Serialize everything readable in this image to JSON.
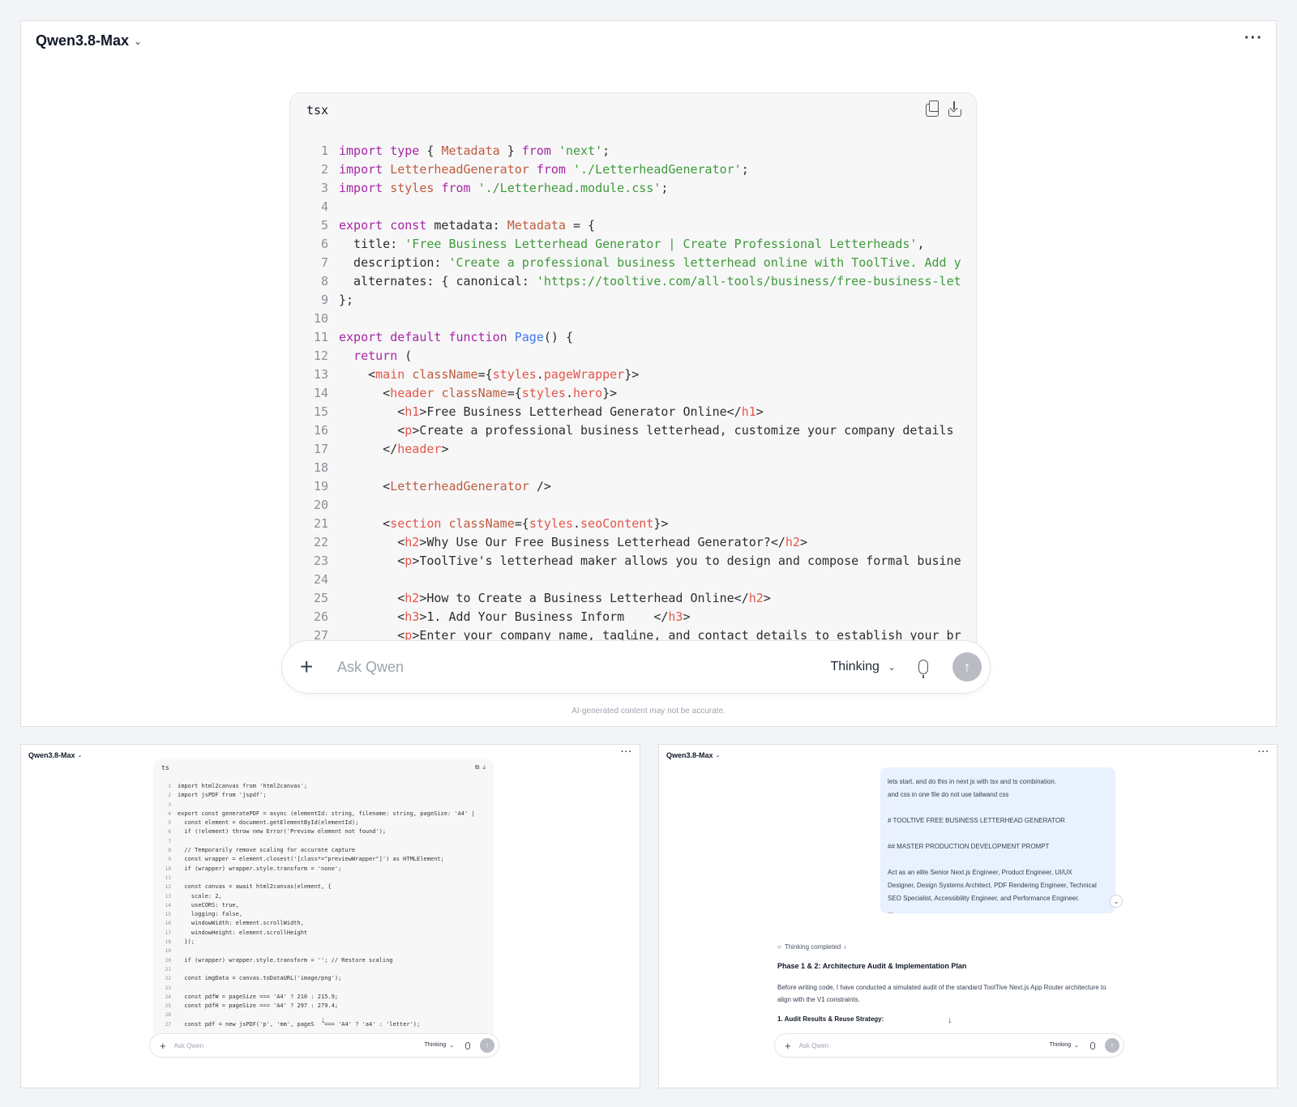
{
  "main": {
    "model_name": "Qwen3.8-Max",
    "more": "···",
    "code_lang": "tsx",
    "code_lines": [
      [
        {
          "t": "import",
          "c": "k"
        },
        {
          "t": " "
        },
        {
          "t": "type",
          "c": "k"
        },
        {
          "t": " { "
        },
        {
          "t": "Metadata",
          "c": "t"
        },
        {
          "t": " } "
        },
        {
          "t": "from",
          "c": "k"
        },
        {
          "t": " "
        },
        {
          "t": "'next'",
          "c": "s"
        },
        {
          "t": ";"
        }
      ],
      [
        {
          "t": "import",
          "c": "k"
        },
        {
          "t": " "
        },
        {
          "t": "LetterheadGenerator",
          "c": "t"
        },
        {
          "t": " "
        },
        {
          "t": "from",
          "c": "k"
        },
        {
          "t": " "
        },
        {
          "t": "'./LetterheadGenerator'",
          "c": "s"
        },
        {
          "t": ";"
        }
      ],
      [
        {
          "t": "import",
          "c": "k"
        },
        {
          "t": " "
        },
        {
          "t": "styles",
          "c": "t"
        },
        {
          "t": " "
        },
        {
          "t": "from",
          "c": "k"
        },
        {
          "t": " "
        },
        {
          "t": "'./Letterhead.module.css'",
          "c": "s"
        },
        {
          "t": ";"
        }
      ],
      [],
      [
        {
          "t": "export",
          "c": "k"
        },
        {
          "t": " "
        },
        {
          "t": "const",
          "c": "k"
        },
        {
          "t": " metadata: "
        },
        {
          "t": "Metadata",
          "c": "t"
        },
        {
          "t": " = {"
        }
      ],
      [
        {
          "t": "  title: "
        },
        {
          "t": "'Free Business Letterhead Generator | Create Professional Letterheads'",
          "c": "s"
        },
        {
          "t": ","
        }
      ],
      [
        {
          "t": "  description: "
        },
        {
          "t": "'Create a professional business letterhead online with ToolTive. Add you",
          "c": "s"
        }
      ],
      [
        {
          "t": "  alternates: { canonical: "
        },
        {
          "t": "'https://tooltive.com/all-tools/business/free-business-lette",
          "c": "s"
        }
      ],
      [
        {
          "t": "};"
        }
      ],
      [],
      [
        {
          "t": "export",
          "c": "k"
        },
        {
          "t": " "
        },
        {
          "t": "default",
          "c": "k"
        },
        {
          "t": " "
        },
        {
          "t": "function",
          "c": "k"
        },
        {
          "t": " "
        },
        {
          "t": "Page",
          "c": "f"
        },
        {
          "t": "() {"
        }
      ],
      [
        {
          "t": "  "
        },
        {
          "t": "return",
          "c": "k"
        },
        {
          "t": " ("
        }
      ],
      [
        {
          "t": "    <"
        },
        {
          "t": "main",
          "c": "tg"
        },
        {
          "t": " "
        },
        {
          "t": "className",
          "c": "t"
        },
        {
          "t": "={"
        },
        {
          "t": "styles",
          "c": "tg"
        },
        {
          "t": "."
        },
        {
          "t": "pageWrapper",
          "c": "tg"
        },
        {
          "t": "}>"
        }
      ],
      [
        {
          "t": "      <"
        },
        {
          "t": "header",
          "c": "tg"
        },
        {
          "t": " "
        },
        {
          "t": "className",
          "c": "t"
        },
        {
          "t": "={"
        },
        {
          "t": "styles",
          "c": "tg"
        },
        {
          "t": "."
        },
        {
          "t": "hero",
          "c": "tg"
        },
        {
          "t": "}>"
        }
      ],
      [
        {
          "t": "        <"
        },
        {
          "t": "h1",
          "c": "tg"
        },
        {
          "t": ">Free Business Letterhead Generator Online</"
        },
        {
          "t": "h1",
          "c": "tg"
        },
        {
          "t": ">"
        }
      ],
      [
        {
          "t": "        <"
        },
        {
          "t": "p",
          "c": "tg"
        },
        {
          "t": ">Create a professional business letterhead, customize your company details ar"
        }
      ],
      [
        {
          "t": "      </"
        },
        {
          "t": "header",
          "c": "tg"
        },
        {
          "t": ">"
        }
      ],
      [],
      [
        {
          "t": "      <"
        },
        {
          "t": "LetterheadGenerator",
          "c": "t"
        },
        {
          "t": " />"
        }
      ],
      [],
      [
        {
          "t": "      <"
        },
        {
          "t": "section",
          "c": "tg"
        },
        {
          "t": " "
        },
        {
          "t": "className",
          "c": "t"
        },
        {
          "t": "={"
        },
        {
          "t": "styles",
          "c": "tg"
        },
        {
          "t": "."
        },
        {
          "t": "seoContent",
          "c": "tg"
        },
        {
          "t": "}>"
        }
      ],
      [
        {
          "t": "        <"
        },
        {
          "t": "h2",
          "c": "tg"
        },
        {
          "t": ">Why Use Our Free Business Letterhead Generator?</"
        },
        {
          "t": "h2",
          "c": "tg"
        },
        {
          "t": ">"
        }
      ],
      [
        {
          "t": "        <"
        },
        {
          "t": "p",
          "c": "tg"
        },
        {
          "t": ">ToolTive's letterhead maker allows you to design and compose formal business"
        }
      ],
      [],
      [
        {
          "t": "        <"
        },
        {
          "t": "h2",
          "c": "tg"
        },
        {
          "t": ">How to Create a Business Letterhead Online</"
        },
        {
          "t": "h2",
          "c": "tg"
        },
        {
          "t": ">"
        }
      ],
      [
        {
          "t": "        <"
        },
        {
          "t": "h3",
          "c": "tg"
        },
        {
          "t": ">1. Add Your Business Inform    </"
        },
        {
          "t": "h3",
          "c": "tg"
        },
        {
          "t": ">"
        }
      ],
      [
        {
          "t": "        <"
        },
        {
          "t": "p",
          "c": "tg"
        },
        {
          "t": ">Enter your company name, tagline, and contact details to establish your brar"
        }
      ]
    ],
    "ask_placeholder": "Ask Qwen",
    "mode_label": "Thinking",
    "disclaimer": "AI-generated content may not be accurate."
  },
  "left": {
    "model_name": "Qwen3.8-Max",
    "more": "···",
    "code_lang": "ts",
    "code_lines": [
      "import html2canvas from 'html2canvas';",
      "import jsPDF from 'jspdf';",
      "",
      "export const generatePDF = async (elementId: string, filename: string, pageSize: 'A4' |",
      "  const element = document.getElementById(elementId);",
      "  if (!element) throw new Error('Preview element not found');",
      "",
      "  // Temporarily remove scaling for accurate capture",
      "  const wrapper = element.closest('[class*=\"previewWrapper\"]') as HTMLElement;",
      "  if (wrapper) wrapper.style.transform = 'none';",
      "",
      "  const canvas = await html2canvas(element, {",
      "    scale: 2,",
      "    useCORS: true,",
      "    logging: false,",
      "    windowWidth: element.scrollWidth,",
      "    windowHeight: element.scrollHeight",
      "  });",
      "",
      "  if (wrapper) wrapper.style.transform = ''; // Restore scaling",
      "",
      "  const imgData = canvas.toDataURL('image/png');",
      "",
      "  const pdfW = pageSize === 'A4' ? 210 : 215.9;",
      "  const pdfH = pageSize === 'A4' ? 297 : 279.4;",
      "",
      "  const pdf = new jsPDF('p', 'mm', pageS   === 'A4' ? 'a4' : 'letter');"
    ],
    "ask_placeholder": "Ask Qwen",
    "mode_label": "Thinking"
  },
  "right": {
    "model_name": "Qwen3.8-Max",
    "more": "···",
    "user_message": [
      "lets start. and do this in next js with tsx and ts combination.",
      "and css in one file do not use tailwand css",
      "",
      "# TOOLTIVE FREE BUSINESS LETTERHEAD GENERATOR",
      "",
      "## MASTER PRODUCTION DEVELOPMENT PROMPT",
      "",
      "Act as an elite Senior Next.js Engineer, Product Engineer, UI/UX",
      "Designer, Design Systems Architect, PDF Rendering Engineer, Technical",
      "SEO Specialist, Accessibility Engineer, and Performance Engineer.",
      "..."
    ],
    "thinking_status": "Thinking completed",
    "answer_title": "Phase 1 & 2: Architecture Audit & Implementation Plan",
    "answer_text": "Before writing code, I have conducted a simulated audit of the standard ToolTive Next.js App Router architecture to align with the V1 constraints.",
    "answer_subheading": "1. Audit Results & Reuse Strategy:",
    "ask_placeholder": "Ask Qwen",
    "mode_label": "Thinking"
  },
  "icons": {
    "chevron": "chevron-down-icon",
    "copy": "copy-icon",
    "download": "download-icon",
    "plus": "plus-icon",
    "mic": "microphone-icon",
    "send": "send-arrow-icon",
    "scroll": "arrow-down-icon",
    "bulb": "lightbulb-icon"
  }
}
